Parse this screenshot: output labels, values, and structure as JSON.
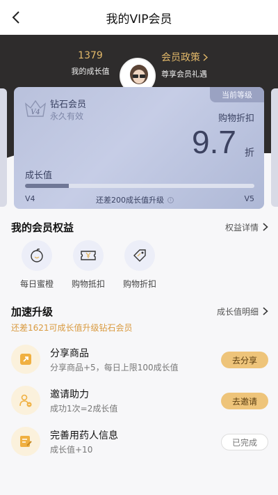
{
  "header": {
    "title": "我的VIP会员"
  },
  "summary": {
    "growth_value": "1379",
    "growth_label": "我的成长值",
    "policy_title": "会员政策",
    "policy_sub": "尊享会员礼遇"
  },
  "card": {
    "badge": "当前等级",
    "level_mark": "V4",
    "level_name": "钻石会员",
    "validity": "永久有效",
    "discount_label": "购物折扣",
    "discount_value": "9.7",
    "discount_unit": "折",
    "growth_label": "成长值",
    "progress_fraction": 0.19,
    "level_current": "V4",
    "level_next": "V5",
    "upgrade_hint": "还差200成长值升级",
    "info_icon": "info-icon"
  },
  "benefits": {
    "title": "我的会员权益",
    "detail_link": "权益详情",
    "items": [
      {
        "label": "每日蜜橙",
        "icon": "orange-icon"
      },
      {
        "label": "购物抵扣",
        "icon": "ticket-yen-icon"
      },
      {
        "label": "购物折扣",
        "icon": "price-tag-icon"
      }
    ]
  },
  "accelerate": {
    "title": "加速升级",
    "detail_link": "成长值明细",
    "tip": "还差1621可成长值升级钻石会员",
    "tasks": [
      {
        "title": "分享商品",
        "desc": "分享商品+5，每日上限100成长值",
        "button": "去分享",
        "state": "todo",
        "icon": "share-icon"
      },
      {
        "title": "邀请助力",
        "desc": "成功1次=2成长值",
        "button": "去邀请",
        "state": "todo",
        "icon": "invite-user-icon"
      },
      {
        "title": "完善用药人信息",
        "desc": "成长值+10",
        "button": "已完成",
        "state": "done",
        "icon": "edit-profile-icon"
      }
    ]
  },
  "colors": {
    "accent_gold": "#e3b96a",
    "button_gold": "#eec47a",
    "hero_dark": "#2e2c2c",
    "card_blue": "#b9c1dc"
  }
}
